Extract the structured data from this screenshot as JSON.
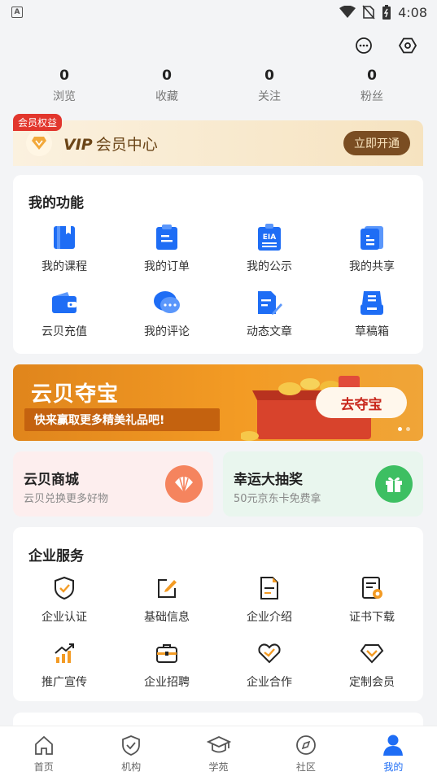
{
  "status_bar": {
    "time": "4:08",
    "left_badge": "A"
  },
  "top_icons": [
    "chat-bubble-icon",
    "settings-hexagon-icon"
  ],
  "stats": [
    {
      "value": "0",
      "label": "浏览"
    },
    {
      "value": "0",
      "label": "收藏"
    },
    {
      "value": "0",
      "label": "关注"
    },
    {
      "value": "0",
      "label": "粉丝"
    }
  ],
  "vip": {
    "tag": "会员权益",
    "title_prefix": "VIP",
    "title": "会员中心",
    "button": "立即开通"
  },
  "my_functions": {
    "title": "我的功能",
    "items": [
      {
        "label": "我的课程",
        "icon": "book-icon"
      },
      {
        "label": "我的订单",
        "icon": "clipboard-icon"
      },
      {
        "label": "我的公示",
        "icon": "eia-board-icon",
        "icon_text": "EIA"
      },
      {
        "label": "我的共享",
        "icon": "share-doc-icon"
      },
      {
        "label": "云贝充值",
        "icon": "wallet-icon"
      },
      {
        "label": "我的评论",
        "icon": "comment-icon"
      },
      {
        "label": "动态文章",
        "icon": "article-edit-icon"
      },
      {
        "label": "草稿箱",
        "icon": "draft-box-icon"
      }
    ]
  },
  "banner": {
    "title": "云贝夺宝",
    "subtitle": "快来赢取更多精美礼品吧!",
    "button": "去夺宝",
    "slides": 2,
    "active_slide": 1
  },
  "promos": [
    {
      "title": "云贝商城",
      "subtitle": "云贝兑换更多好物",
      "icon": "shell-icon",
      "bg": "#fdeeee",
      "icon_bg": "#f5845e"
    },
    {
      "title": "幸运大抽奖",
      "subtitle": "50元京东卡免费拿",
      "icon": "gift-icon",
      "bg": "#e9f6ee",
      "icon_bg": "#3dbf62"
    }
  ],
  "enterprise": {
    "title": "企业服务",
    "items": [
      {
        "label": "企业认证",
        "icon": "shield-check-icon"
      },
      {
        "label": "基础信息",
        "icon": "edit-icon"
      },
      {
        "label": "企业介绍",
        "icon": "document-icon"
      },
      {
        "label": "证书下载",
        "icon": "certificate-icon"
      },
      {
        "label": "推广宣传",
        "icon": "chart-up-icon"
      },
      {
        "label": "企业招聘",
        "icon": "briefcase-icon"
      },
      {
        "label": "企业合作",
        "icon": "handshake-icon"
      },
      {
        "label": "定制会员",
        "icon": "diamond-icon"
      }
    ]
  },
  "tabbar": [
    {
      "label": "首页",
      "icon": "home-icon"
    },
    {
      "label": "机构",
      "icon": "shield-icon"
    },
    {
      "label": "学苑",
      "icon": "graduation-cap-icon"
    },
    {
      "label": "社区",
      "icon": "compass-icon"
    },
    {
      "label": "我的",
      "icon": "user-icon",
      "active": true
    }
  ],
  "colors": {
    "accent_blue": "#1e6df5",
    "accent_orange": "#f39b24",
    "vip_brown": "#7a4d22",
    "red": "#e2362d"
  }
}
